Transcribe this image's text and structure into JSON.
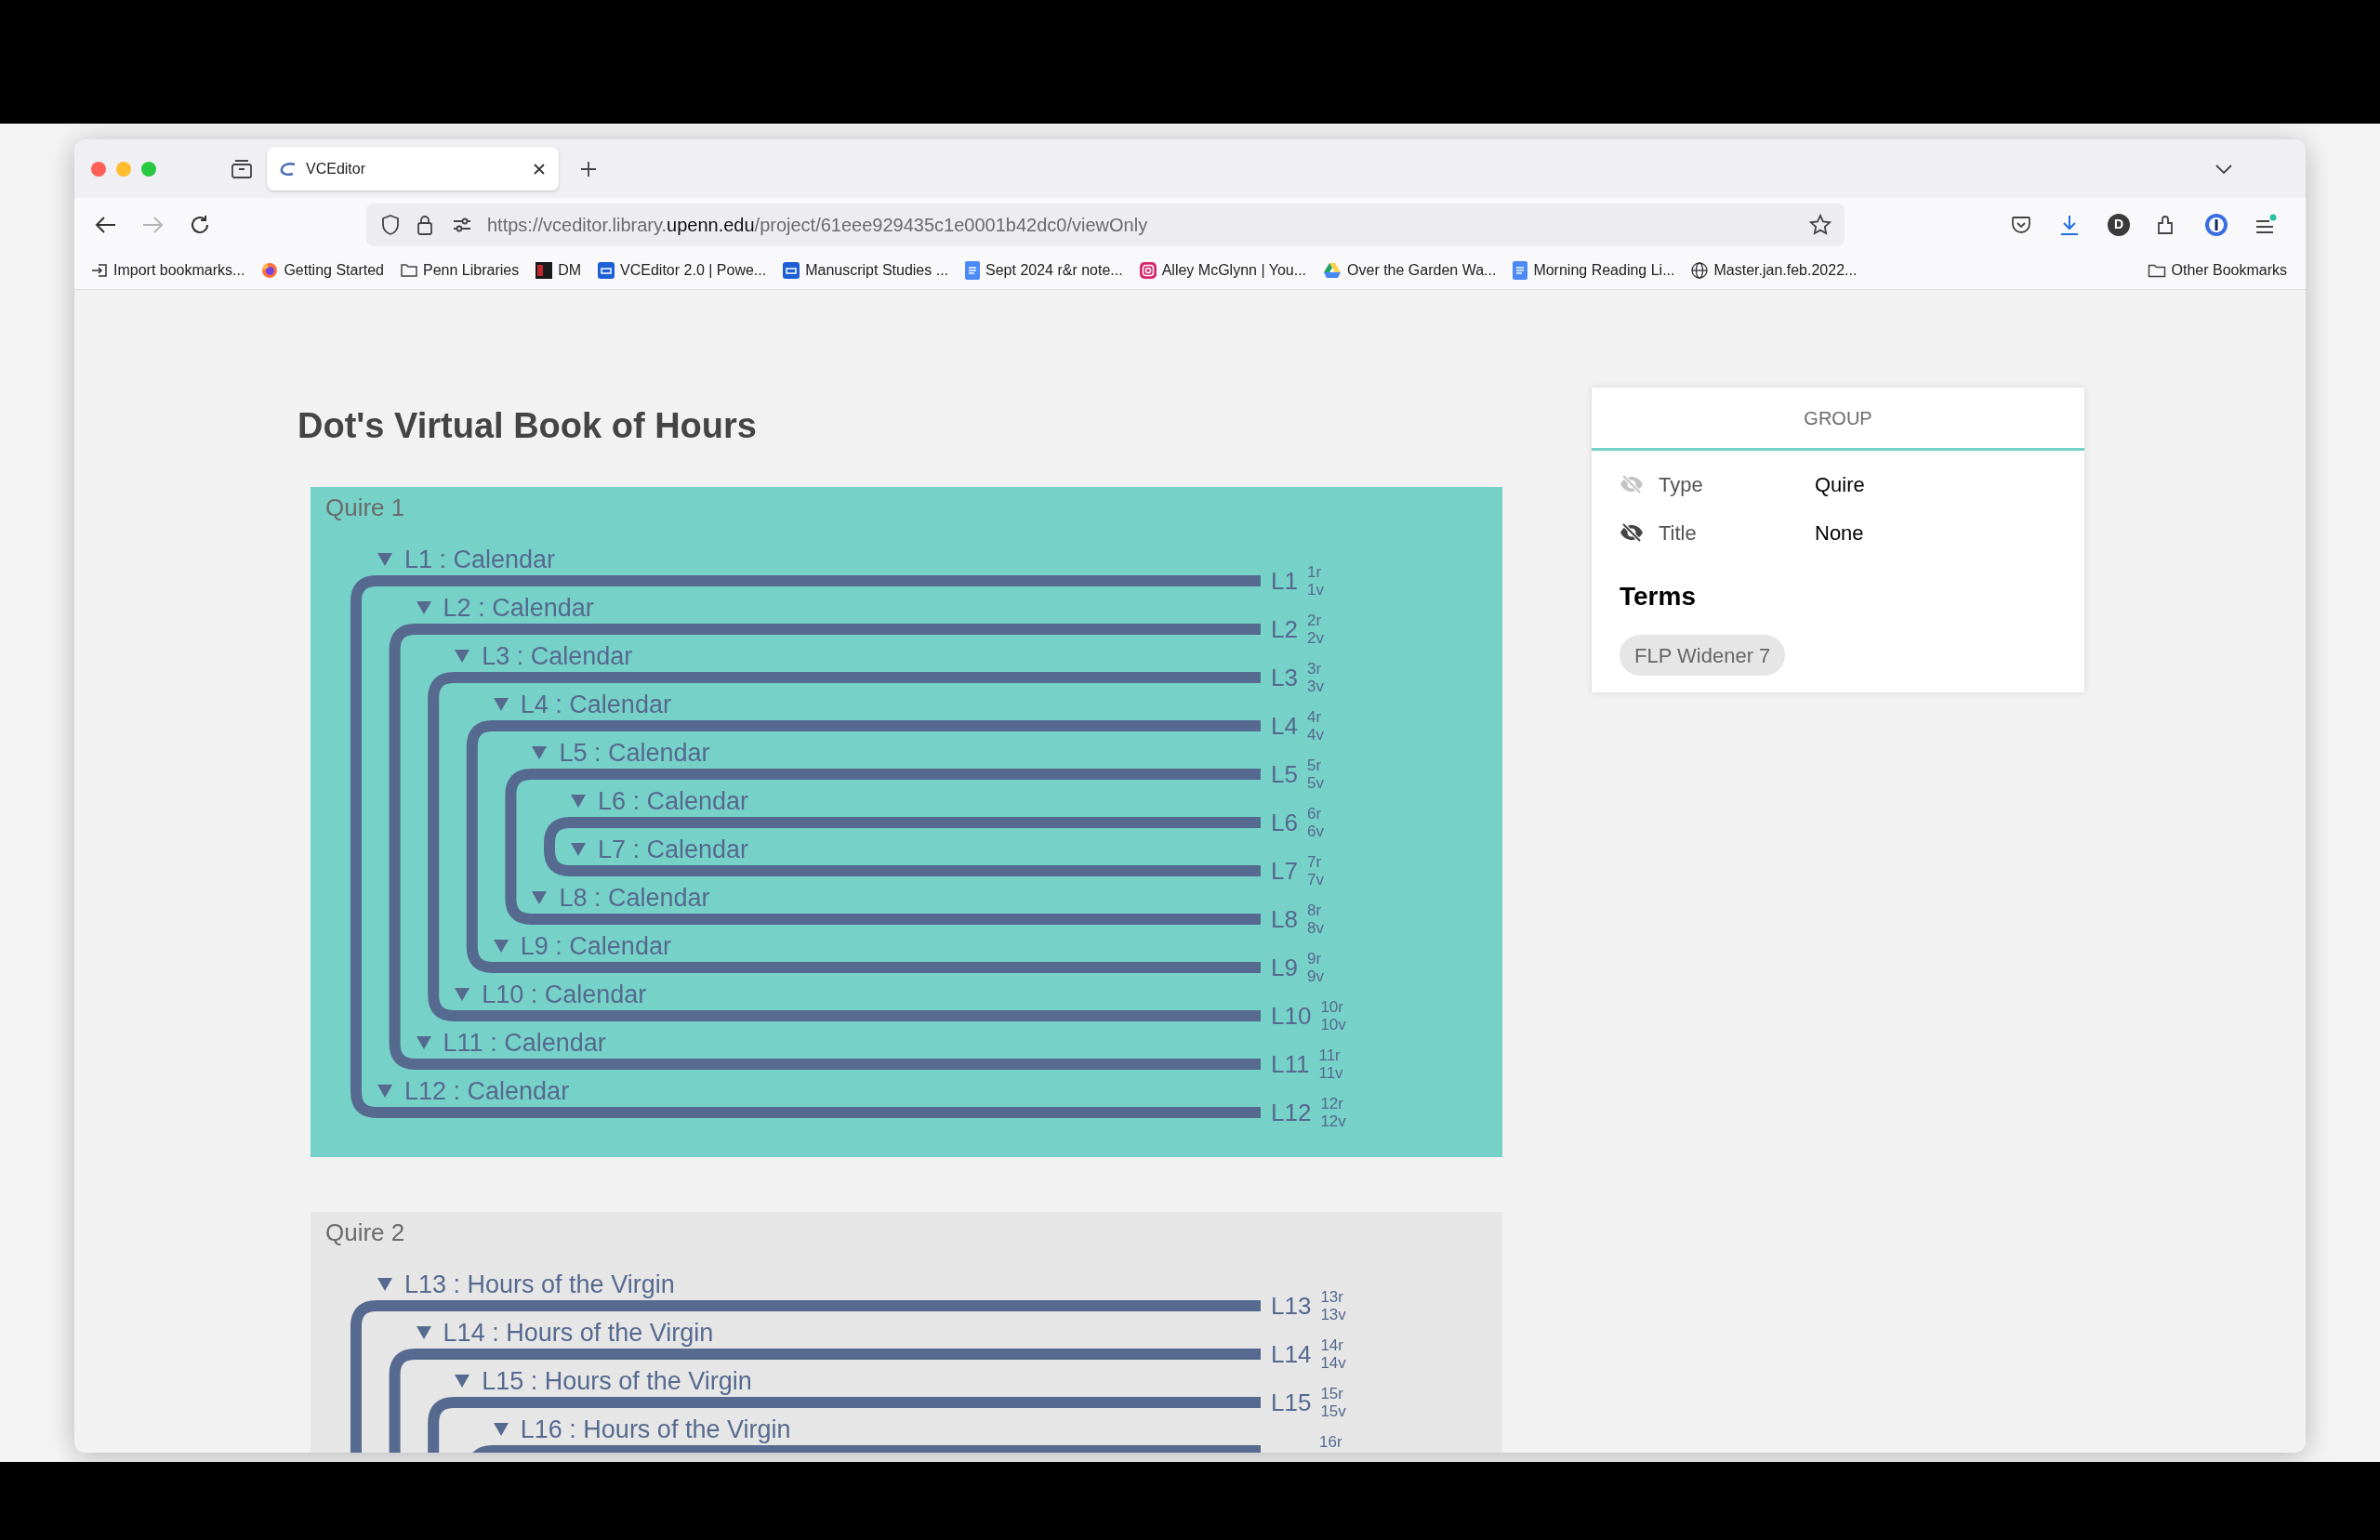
{
  "browser": {
    "tabs": [
      {
        "title": "VCEditor",
        "selected": true
      }
    ],
    "navigation": {
      "back_enabled": true,
      "forward_enabled": false
    },
    "url": {
      "prefix": "https://vceditor.library.",
      "domain": "upenn.edu",
      "path": "/project/61eee929435c1e0001b42dc0/viewOnly"
    },
    "profile_initial": "D",
    "bookmarks": [
      {
        "label": "Import bookmarks...",
        "kind": "import"
      },
      {
        "label": "Getting Started",
        "kind": "firefox"
      },
      {
        "label": "Penn Libraries",
        "kind": "folder"
      },
      {
        "label": "DM",
        "kind": "dm"
      },
      {
        "label": "VCEditor 2.0 | Powe...",
        "kind": "box"
      },
      {
        "label": "Manuscript Studies ...",
        "kind": "box"
      },
      {
        "label": "Sept 2024 r&r note...",
        "kind": "docs"
      },
      {
        "label": "Alley McGlynn | You...",
        "kind": "instagram"
      },
      {
        "label": "Over the Garden Wa...",
        "kind": "drive"
      },
      {
        "label": "Morning Reading Li...",
        "kind": "docs"
      },
      {
        "label": "Master.jan.feb.2022...",
        "kind": "globe"
      }
    ],
    "other_bookmarks": "Other Bookmarks"
  },
  "page": {
    "title": "Dot's Virtual Book of Hours",
    "quires": [
      {
        "name": "Quire 1",
        "selected": true,
        "structure": [
          {
            "leaves": [
              {
                "label": "L1 : Calendar",
                "number": "L1",
                "folios": [
                  "1r",
                  "1v"
                ]
              },
              {
                "label": "L12 : Calendar",
                "number": "L12",
                "folios": [
                  "12r",
                  "12v"
                ]
              }
            ],
            "children": [
              {
                "leaves": [
                  {
                    "label": "L2 : Calendar",
                    "number": "L2",
                    "folios": [
                      "2r",
                      "2v"
                    ]
                  },
                  {
                    "label": "L11 : Calendar",
                    "number": "L11",
                    "folios": [
                      "11r",
                      "11v"
                    ]
                  }
                ],
                "children": [
                  {
                    "leaves": [
                      {
                        "label": "L3 : Calendar",
                        "number": "L3",
                        "folios": [
                          "3r",
                          "3v"
                        ]
                      },
                      {
                        "label": "L10 : Calendar",
                        "number": "L10",
                        "folios": [
                          "10r",
                          "10v"
                        ]
                      }
                    ],
                    "children": [
                      {
                        "leaves": [
                          {
                            "label": "L4 : Calendar",
                            "number": "L4",
                            "folios": [
                              "4r",
                              "4v"
                            ]
                          },
                          {
                            "label": "L9 : Calendar",
                            "number": "L9",
                            "folios": [
                              "9r",
                              "9v"
                            ]
                          }
                        ],
                        "children": [
                          {
                            "leaves": [
                              {
                                "label": "L5 : Calendar",
                                "number": "L5",
                                "folios": [
                                  "5r",
                                  "5v"
                                ]
                              },
                              {
                                "label": "L8 : Calendar",
                                "number": "L8",
                                "folios": [
                                  "8r",
                                  "8v"
                                ]
                              }
                            ],
                            "children": [
                              {
                                "leaves": [
                                  {
                                    "label": "L6 : Calendar",
                                    "number": "L6",
                                    "folios": [
                                      "6r",
                                      "6v"
                                    ]
                                  },
                                  {
                                    "label": "L7 : Calendar",
                                    "number": "L7",
                                    "folios": [
                                      "7r",
                                      "7v"
                                    ]
                                  }
                                ]
                              }
                            ]
                          }
                        ]
                      }
                    ]
                  }
                ]
              }
            ]
          }
        ]
      },
      {
        "name": "Quire 2",
        "selected": false,
        "structure": [
          {
            "leaves": [
              {
                "label": "L13 : Hours of the Virgin",
                "number": "L13",
                "folios": [
                  "13r",
                  "13v"
                ]
              }
            ],
            "children": [
              {
                "leaves": [
                  {
                    "label": "L14 : Hours of the Virgin",
                    "number": "L14",
                    "folios": [
                      "14r",
                      "14v"
                    ]
                  }
                ],
                "children": [
                  {
                    "leaves": [
                      {
                        "label": "L15 : Hours of the Virgin",
                        "number": "L15",
                        "folios": [
                          "15r",
                          "15v"
                        ]
                      }
                    ],
                    "children": [
                      {
                        "leaves": [
                          {
                            "label": "L16 : Hours of the Virgin",
                            "folios": [
                              "16r"
                            ]
                          }
                        ]
                      }
                    ]
                  }
                ]
              }
            ]
          }
        ]
      }
    ]
  },
  "panel": {
    "header": "GROUP",
    "attributes": [
      {
        "label": "Type",
        "value": "Quire",
        "active": false
      },
      {
        "label": "Title",
        "value": "None",
        "active": true
      }
    ],
    "terms_heading": "Terms",
    "terms": [
      "FLP Widener 7"
    ]
  }
}
